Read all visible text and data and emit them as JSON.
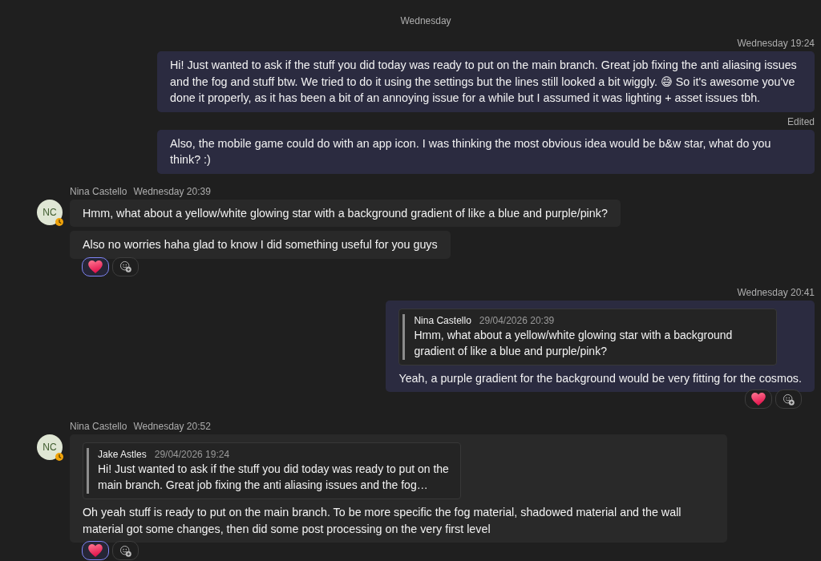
{
  "timeline": [
    {
      "kind": "date_divider",
      "label": "Wednesday"
    },
    {
      "kind": "outgoing",
      "messages": [
        {
          "time": "Wednesday 19:24",
          "text": "Hi! Just wanted to ask if the stuff you did today was ready to put on the main branch. Great job fixing the anti aliasing issues and the fog and stuff btw. We tried to do it using the settings but the lines still looked a bit wiggly. 😅 So it's awesome you've done it properly, as it has been a bit of an annoying issue for a while but I assumed it was lighting + asset issues tbh."
        },
        {
          "edited_label": "Edited",
          "text": "Also, the mobile game could do with an app icon. I was thinking the most obvious idea would be b&w star, what do you think? :)"
        }
      ]
    },
    {
      "kind": "incoming",
      "sender": "Nina Castello",
      "time": "Wednesday 20:39",
      "avatar": {
        "initials": "NC",
        "away": true
      },
      "messages": [
        {
          "text": "Hmm, what about a yellow/white glowing star with a background gradient of like a blue and purple/pink?"
        },
        {
          "text": "Also no worries haha glad to know I did something useful for you guys",
          "reactions": [
            {
              "kind": "heart",
              "selected": true
            }
          ],
          "add_reaction": true
        }
      ]
    },
    {
      "kind": "outgoing",
      "messages": [
        {
          "time": "Wednesday 20:41",
          "quote": {
            "sender": "Nina Castello",
            "time": "29/04/2026 20:39",
            "text": "Hmm, what about a yellow/white glowing star with a background gradient of like a blue and purple/pink?"
          },
          "text": "Yeah, a purple gradient for the background would be very fitting for the cosmos.",
          "reactions": [
            {
              "kind": "heart",
              "selected": false
            }
          ],
          "add_reaction": true
        }
      ]
    },
    {
      "kind": "incoming",
      "sender": "Nina Castello",
      "time": "Wednesday 20:52",
      "avatar": {
        "initials": "NC",
        "away": true
      },
      "messages": [
        {
          "quote": {
            "sender": "Jake Astles",
            "time": "29/04/2026 19:24",
            "text": "Hi! Just wanted to ask if the stuff you did today was ready to put on the main branch. Great job fixing the anti aliasing issues and the fog…"
          },
          "text": "Oh yeah stuff is ready to put on the main branch. To be more specific the fog material, shadowed material and the wall material got some changes, then did some post processing on the very first level",
          "reactions": [
            {
              "kind": "heart",
              "selected": true
            }
          ],
          "add_reaction": true
        }
      ]
    }
  ]
}
